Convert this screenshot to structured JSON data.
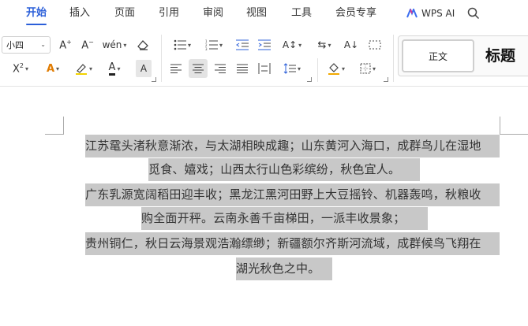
{
  "menu": {
    "items": [
      "开始",
      "插入",
      "页面",
      "引用",
      "审阅",
      "视图",
      "工具",
      "会员专享"
    ],
    "active": "开始",
    "wps_ai": "WPS AI"
  },
  "toolbar": {
    "font_size": "小四",
    "style_normal": "正文",
    "style_heading": "标题"
  },
  "document": {
    "lines": [
      "江苏鼋头渚秋意渐浓，与太湖相映成趣；山东黄河入海口，成群鸟儿在湿地",
      "觅食、嬉戏；山西太行山色彩缤纷，秋色宜人。",
      "广东乳源宽阔稻田迎丰收；黑龙江黑河田野上大豆摇铃、机器轰鸣，秋粮收",
      "购全面开秤。云南永善千亩梯田，一派丰收景象；",
      "贵州铜仁，秋日云海景观浩瀚缥缈；新疆额尔齐斯河流域，成群候鸟飞翔在",
      "湖光秋色之中。"
    ]
  },
  "colors": {
    "accent": "#2b5fd9",
    "selection": "#c8c8c8"
  }
}
